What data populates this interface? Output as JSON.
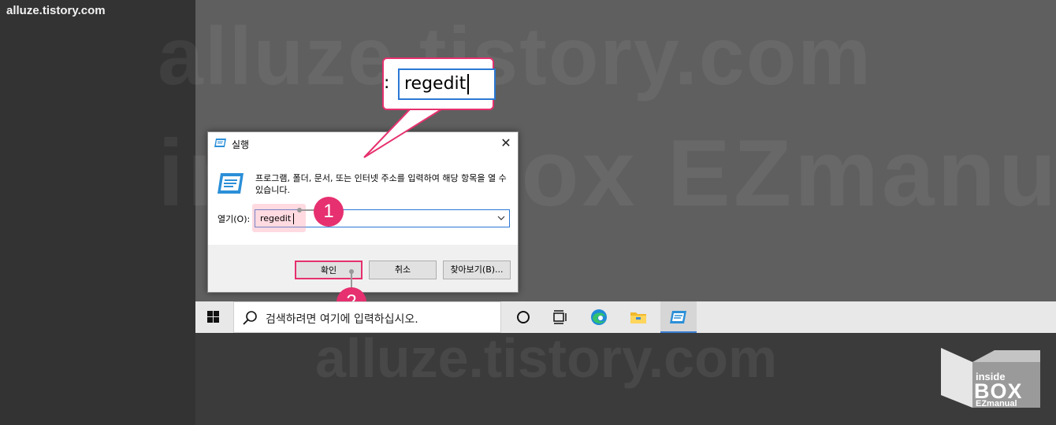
{
  "site": {
    "label": "alluze.tistory.com"
  },
  "watermarks": {
    "top": "alluze.tistory.com",
    "middle": "insideBox EZmanual",
    "bottom": "alluze.tistory.com"
  },
  "callout": {
    "value": "regedit"
  },
  "dialog": {
    "title": "실행",
    "close_glyph": "✕",
    "description": "프로그램, 폴더, 문서, 또는 인터넷 주소를 입력하여 해당 항목을 열 수 있습니다.",
    "open_label": "열기(O):",
    "open_value": "regedit",
    "ok_label": "확인",
    "cancel_label": "취소",
    "browse_label": "찾아보기(B)..."
  },
  "markers": {
    "one": "1",
    "two": "2"
  },
  "taskbar": {
    "search_placeholder": "검색하려면 여기에 입력하십시오.",
    "icons": [
      "windows-start-icon",
      "search-icon",
      "cortana-icon",
      "task-view-icon",
      "edge-icon",
      "file-explorer-icon",
      "run-app-icon"
    ]
  },
  "logo": {
    "line1": "inside",
    "line2": "BOX",
    "line3": "EZmanual"
  },
  "colors": {
    "accent": "#e6306f",
    "focus": "#2a78d4",
    "taskbar": "#e8e8e8"
  }
}
